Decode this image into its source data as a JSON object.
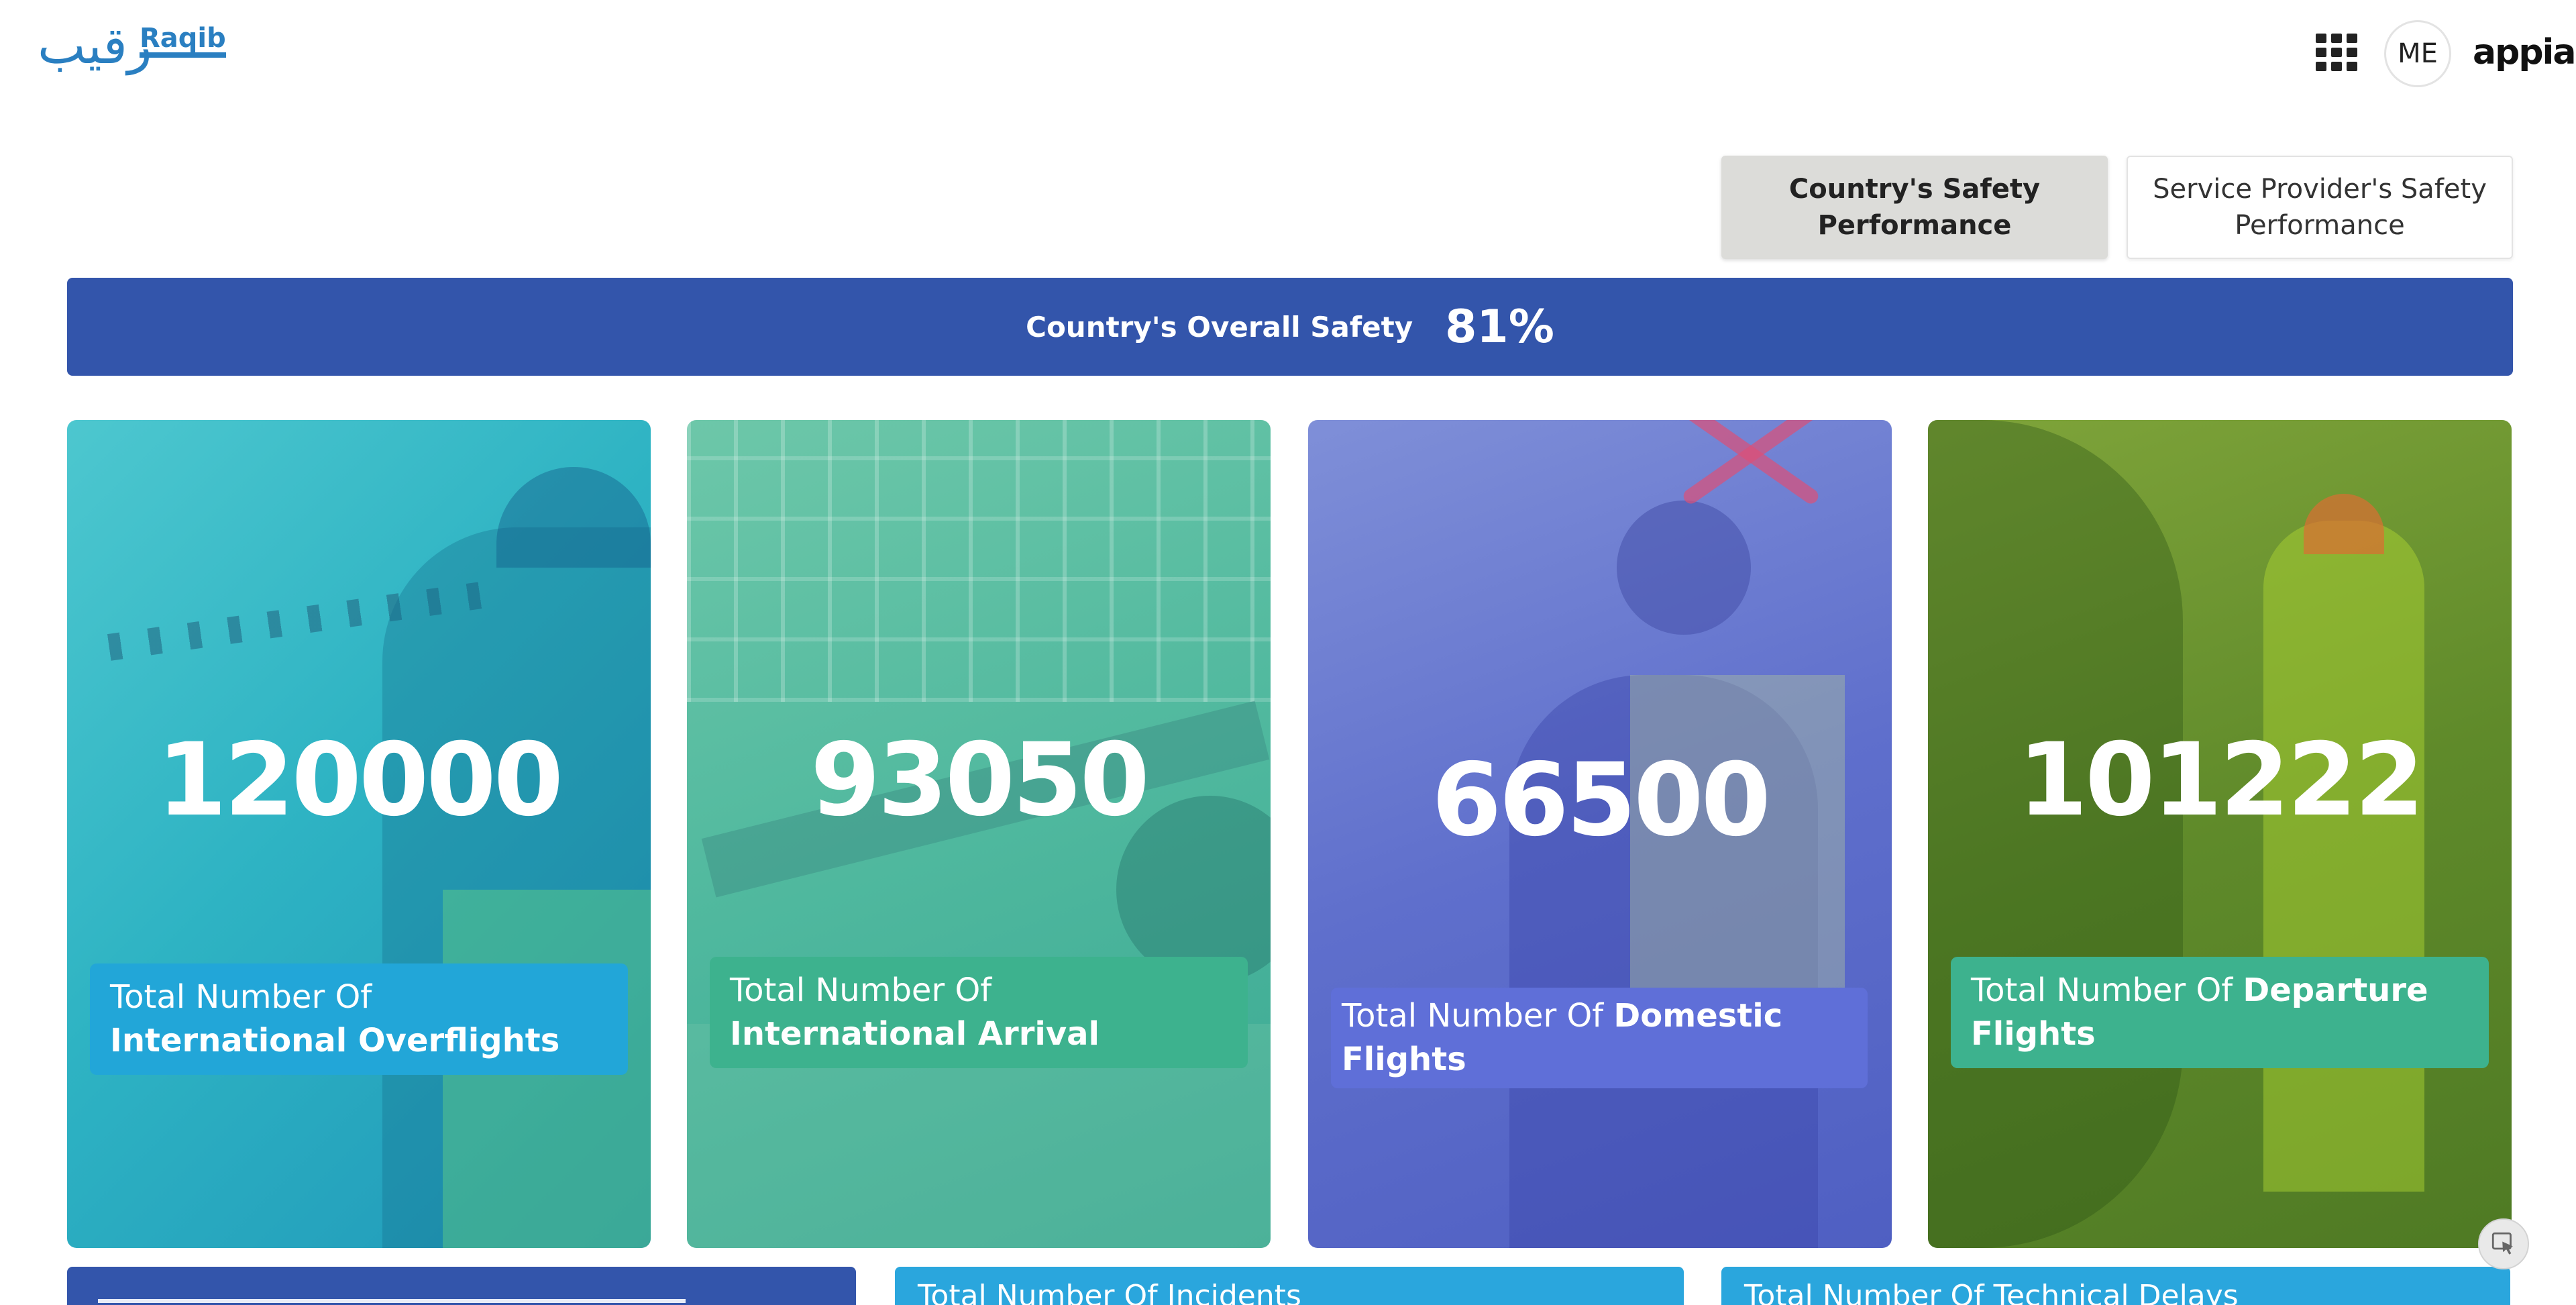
{
  "header": {
    "logo_arabic": "رقيب",
    "logo_english": "Raqib",
    "avatar_initials": "ME",
    "brand": "appian"
  },
  "tabs": [
    {
      "label": "Country's Safety Performance",
      "active": true
    },
    {
      "label": "Service Provider's Safety Performance",
      "active": false
    }
  ],
  "banner": {
    "label": "Country's Overall Safety",
    "value": "81%"
  },
  "cards": [
    {
      "number": "120000",
      "label_prefix": "Total Number Of ",
      "label_bold": "International Overflights",
      "color": "#2eb3c3",
      "label_color": "#22a6d8"
    },
    {
      "number": "93050",
      "label_prefix": "Total Number Of ",
      "label_bold": "International Arrival",
      "color": "#4fb89e",
      "label_color": "#3db28e"
    },
    {
      "number": "66500",
      "label_prefix": "Total Number Of ",
      "label_bold": "Domestic Flights",
      "color": "#5f6fcc",
      "label_color": "#5f6fd8"
    },
    {
      "number": "101222",
      "label_prefix": "Total Number Of ",
      "label_bold": "Departure Flights",
      "color": "#5f8a2a",
      "label_color": "#3db28e"
    }
  ],
  "bottom_cards": [
    {
      "title": ""
    },
    {
      "title": "Total Number Of Incidents"
    },
    {
      "title": "Total Number Of Technical Delays"
    }
  ],
  "colors": {
    "banner": "#3355ab",
    "accent_blue": "#2aa6dd"
  }
}
